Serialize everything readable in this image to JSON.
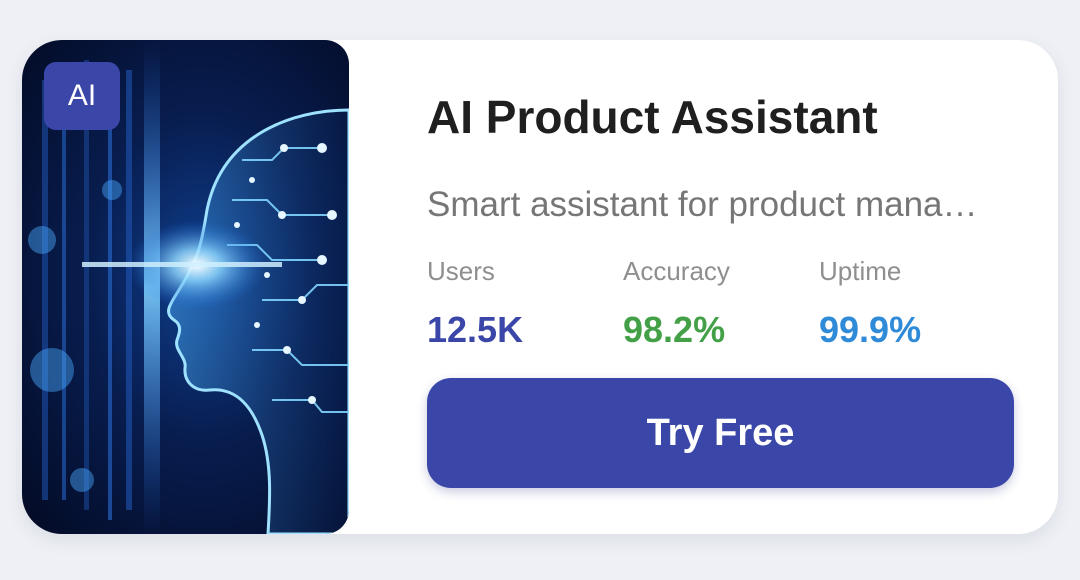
{
  "product": {
    "badge": "AI",
    "title": "AI Product Assistant",
    "subtitle": "Smart assistant for product mana…",
    "image_alt": "ai-head-illustration"
  },
  "stats": [
    {
      "label": "Users",
      "value": "12.5K",
      "color": "#3b47a8"
    },
    {
      "label": "Accuracy",
      "value": "98.2%",
      "color": "#43a047"
    },
    {
      "label": "Uptime",
      "value": "99.9%",
      "color": "#2f8bd8"
    }
  ],
  "cta": {
    "label": "Try Free"
  },
  "colors": {
    "accent": "#3b47a8",
    "background": "#eef0f5",
    "card": "#ffffff"
  }
}
